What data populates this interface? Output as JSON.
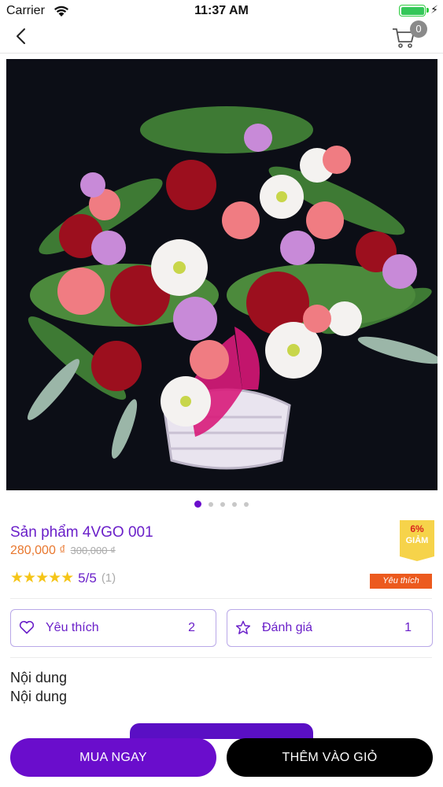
{
  "status_bar": {
    "carrier": "Carrier",
    "time": "11:37 AM"
  },
  "nav": {
    "cart_count": "0"
  },
  "product": {
    "title": "Sản phẩm 4VGO 001",
    "price": "280,000 ₫",
    "old_price": "300,000 ₫",
    "discount_percent": "6%",
    "discount_label": "GIẢM",
    "stars": "★★★★★",
    "rating": "5/5",
    "rating_count": "(1)",
    "favorite_tag": "Yêu thích"
  },
  "pager": {
    "pages": 5,
    "active": 1
  },
  "actions": {
    "like_label": "Yêu thích",
    "like_count": "2",
    "review_label": "Đánh giá",
    "review_count": "1"
  },
  "content": {
    "line1": "Nội dung",
    "line2": "Nội dung"
  },
  "buttons": {
    "buy_now": "MUA NGAY",
    "add_to_cart": "THÊM VÀO GIỎ"
  },
  "colors": {
    "accent": "#6a0dcc",
    "price": "#e8772e",
    "tag": "#ec5a1e",
    "badge": "#f6d34a"
  }
}
